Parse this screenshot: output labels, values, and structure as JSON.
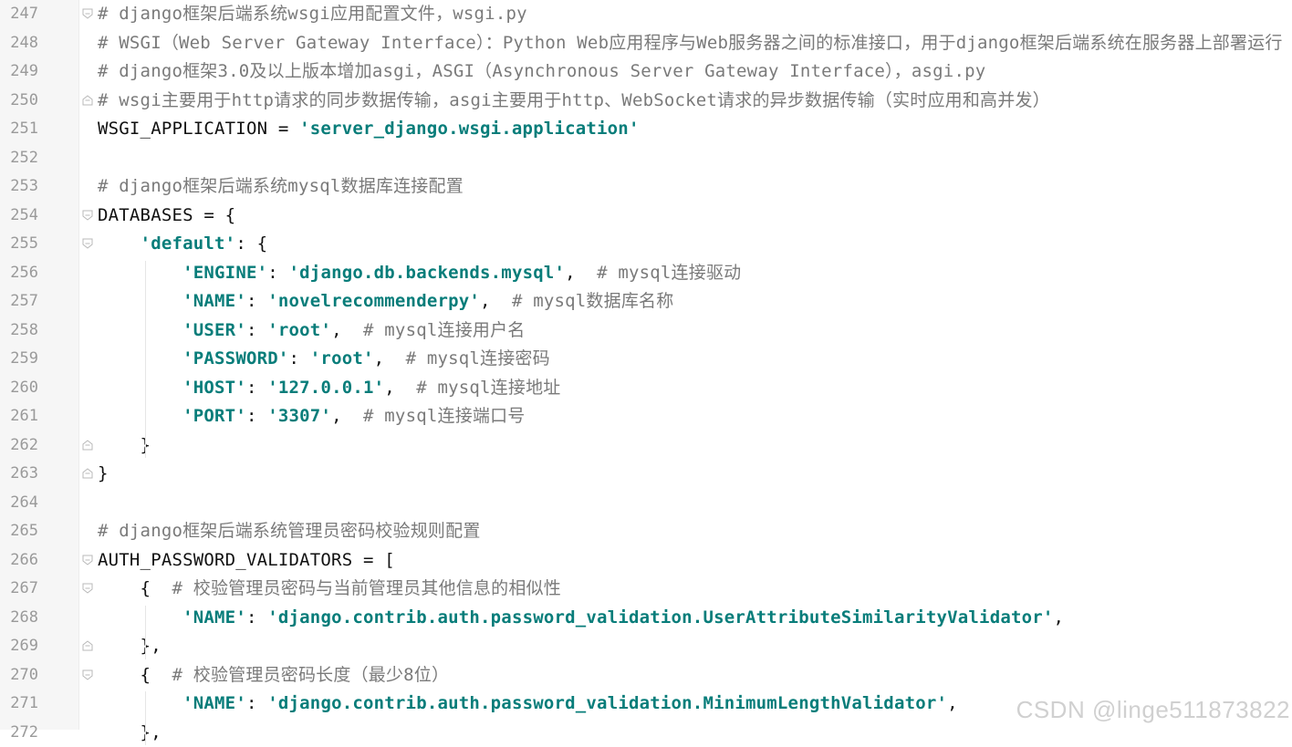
{
  "editor": {
    "lines": [
      {
        "num": "247",
        "fold": "open",
        "segments": [
          {
            "t": "comment",
            "v": "# django框架后端系统wsgi应用配置文件，wsgi.py"
          }
        ]
      },
      {
        "num": "248",
        "fold": "",
        "segments": [
          {
            "t": "comment",
            "v": "# WSGI（Web Server Gateway Interface）：Python Web应用程序与Web服务器之间的标准接口，用于django框架后端系统在服务器上部署运行"
          }
        ]
      },
      {
        "num": "249",
        "fold": "",
        "segments": [
          {
            "t": "comment",
            "v": "# django框架3.0及以上版本增加asgi，ASGI（Asynchronous Server Gateway Interface），asgi.py"
          }
        ]
      },
      {
        "num": "250",
        "fold": "close",
        "segments": [
          {
            "t": "comment",
            "v": "# wsgi主要用于http请求的同步数据传输，asgi主要用于http、WebSocket请求的异步数据传输（实时应用和高并发）"
          }
        ]
      },
      {
        "num": "251",
        "fold": "",
        "segments": [
          {
            "t": "plain",
            "v": "WSGI_APPLICATION = "
          },
          {
            "t": "str",
            "v": "'server_django.wsgi.application'"
          }
        ]
      },
      {
        "num": "252",
        "fold": "",
        "segments": []
      },
      {
        "num": "253",
        "fold": "",
        "segments": [
          {
            "t": "comment",
            "v": "# django框架后端系统mysql数据库连接配置"
          }
        ]
      },
      {
        "num": "254",
        "fold": "open",
        "segments": [
          {
            "t": "plain",
            "v": "DATABASES = {"
          }
        ]
      },
      {
        "num": "255",
        "fold": "open",
        "segments": [
          {
            "t": "plain",
            "v": "    "
          },
          {
            "t": "key",
            "v": "'default'"
          },
          {
            "t": "plain",
            "v": ": {"
          }
        ]
      },
      {
        "num": "256",
        "fold": "",
        "segments": [
          {
            "t": "plain",
            "v": "        "
          },
          {
            "t": "key",
            "v": "'ENGINE'"
          },
          {
            "t": "plain",
            "v": ": "
          },
          {
            "t": "str",
            "v": "'django.db.backends.mysql'"
          },
          {
            "t": "plain",
            "v": ",  "
          },
          {
            "t": "comment",
            "v": "# mysql连接驱动"
          }
        ]
      },
      {
        "num": "257",
        "fold": "",
        "segments": [
          {
            "t": "plain",
            "v": "        "
          },
          {
            "t": "key",
            "v": "'NAME'"
          },
          {
            "t": "plain",
            "v": ": "
          },
          {
            "t": "str",
            "v": "'novelrecommenderpy'"
          },
          {
            "t": "plain",
            "v": ",  "
          },
          {
            "t": "comment",
            "v": "# mysql数据库名称"
          }
        ]
      },
      {
        "num": "258",
        "fold": "",
        "segments": [
          {
            "t": "plain",
            "v": "        "
          },
          {
            "t": "key",
            "v": "'USER'"
          },
          {
            "t": "plain",
            "v": ": "
          },
          {
            "t": "str",
            "v": "'root'"
          },
          {
            "t": "plain",
            "v": ",  "
          },
          {
            "t": "comment",
            "v": "# mysql连接用户名"
          }
        ]
      },
      {
        "num": "259",
        "fold": "",
        "segments": [
          {
            "t": "plain",
            "v": "        "
          },
          {
            "t": "key",
            "v": "'PASSWORD'"
          },
          {
            "t": "plain",
            "v": ": "
          },
          {
            "t": "str",
            "v": "'root'"
          },
          {
            "t": "plain",
            "v": ",  "
          },
          {
            "t": "comment",
            "v": "# mysql连接密码"
          }
        ]
      },
      {
        "num": "260",
        "fold": "",
        "segments": [
          {
            "t": "plain",
            "v": "        "
          },
          {
            "t": "key",
            "v": "'HOST'"
          },
          {
            "t": "plain",
            "v": ": "
          },
          {
            "t": "str",
            "v": "'127.0.0.1'"
          },
          {
            "t": "plain",
            "v": ",  "
          },
          {
            "t": "comment",
            "v": "# mysql连接地址"
          }
        ]
      },
      {
        "num": "261",
        "fold": "",
        "segments": [
          {
            "t": "plain",
            "v": "        "
          },
          {
            "t": "key",
            "v": "'PORT'"
          },
          {
            "t": "plain",
            "v": ": "
          },
          {
            "t": "str",
            "v": "'3307'"
          },
          {
            "t": "plain",
            "v": ",  "
          },
          {
            "t": "comment",
            "v": "# mysql连接端口号"
          }
        ]
      },
      {
        "num": "262",
        "fold": "close",
        "segments": [
          {
            "t": "plain",
            "v": "    }"
          }
        ]
      },
      {
        "num": "263",
        "fold": "close",
        "segments": [
          {
            "t": "plain",
            "v": "}"
          }
        ]
      },
      {
        "num": "264",
        "fold": "",
        "segments": []
      },
      {
        "num": "265",
        "fold": "",
        "segments": [
          {
            "t": "comment",
            "v": "# django框架后端系统管理员密码校验规则配置"
          }
        ]
      },
      {
        "num": "266",
        "fold": "open",
        "segments": [
          {
            "t": "plain",
            "v": "AUTH_PASSWORD_VALIDATORS = ["
          }
        ]
      },
      {
        "num": "267",
        "fold": "open",
        "segments": [
          {
            "t": "plain",
            "v": "    {  "
          },
          {
            "t": "comment",
            "v": "# 校验管理员密码与当前管理员其他信息的相似性"
          }
        ]
      },
      {
        "num": "268",
        "fold": "",
        "segments": [
          {
            "t": "plain",
            "v": "        "
          },
          {
            "t": "key",
            "v": "'NAME'"
          },
          {
            "t": "plain",
            "v": ": "
          },
          {
            "t": "str",
            "v": "'django.contrib.auth.password_validation.UserAttributeSimilarityValidator'"
          },
          {
            "t": "plain",
            "v": ","
          }
        ]
      },
      {
        "num": "269",
        "fold": "close",
        "segments": [
          {
            "t": "plain",
            "v": "    },"
          }
        ]
      },
      {
        "num": "270",
        "fold": "open",
        "segments": [
          {
            "t": "plain",
            "v": "    {  "
          },
          {
            "t": "comment",
            "v": "# 校验管理员密码长度（最少8位）"
          }
        ]
      },
      {
        "num": "271",
        "fold": "",
        "segments": [
          {
            "t": "plain",
            "v": "        "
          },
          {
            "t": "key",
            "v": "'NAME'"
          },
          {
            "t": "plain",
            "v": ": "
          },
          {
            "t": "str",
            "v": "'django.contrib.auth.password_validation.MinimumLengthValidator'"
          },
          {
            "t": "plain",
            "v": ","
          }
        ]
      },
      {
        "num": "272",
        "fold": "",
        "segments": [
          {
            "t": "plain",
            "v": "    },"
          }
        ]
      }
    ]
  },
  "watermark": "CSDN @linge511873822",
  "colors": {
    "comment": "#7a7a7a",
    "string": "#087d7a",
    "plain": "#111111",
    "line_number": "#9a9a9a",
    "gutter_bg": "#f6f6f6"
  }
}
